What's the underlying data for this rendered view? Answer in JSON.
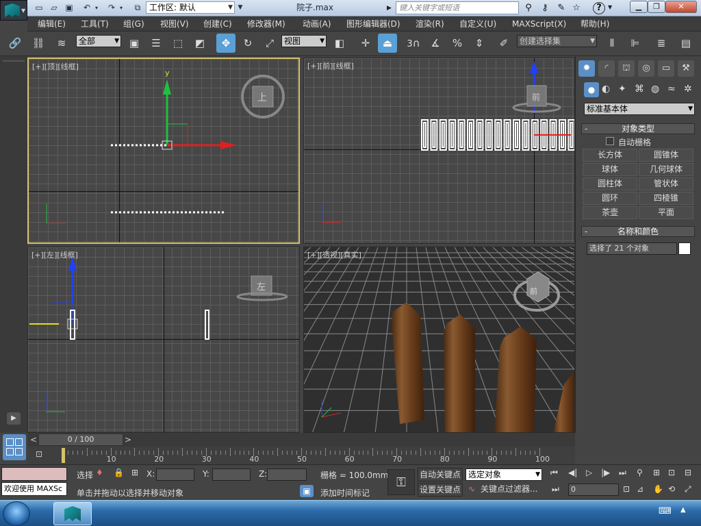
{
  "titlebar": {
    "workspace_label": "工作区: 默认",
    "file_title": "院子.max",
    "search_placeholder": "键入关键字或短语"
  },
  "menubar": {
    "items": [
      "编辑(E)",
      "工具(T)",
      "组(G)",
      "视图(V)",
      "创建(C)",
      "修改器(M)",
      "动画(A)",
      "图形编辑器(D)",
      "渲染(R)",
      "自定义(U)",
      "MAXScript(X)",
      "帮助(H)"
    ]
  },
  "toolbar": {
    "filter_value": "全部",
    "refcoord_value": "视图",
    "snap_number": "3",
    "percent_symbol": "%",
    "selection_set_placeholder": "创建选择集"
  },
  "viewports": {
    "top": {
      "label": "[+][顶][线框]",
      "cube_label": "上"
    },
    "front": {
      "label": "[+][前][线框]",
      "cube_label": "前"
    },
    "left": {
      "label": "[+][左][线框]",
      "cube_label": "左"
    },
    "perspective": {
      "label": "[+][透视][真实]",
      "cube_label": "前"
    }
  },
  "command_panel": {
    "category_value": "标准基本体",
    "object_type_header": "对象类型",
    "autogrid_label": "自动栅格",
    "object_buttons": [
      "长方体",
      "圆锥体",
      "球体",
      "几何球体",
      "圆柱体",
      "管状体",
      "圆环",
      "四棱锥",
      "茶壶",
      "平面"
    ],
    "name_color_header": "名称和颜色",
    "name_field_value": "选择了 21 个对象",
    "object_color": "#ffffff"
  },
  "timeline": {
    "frame_display": "0 / 100",
    "ticks": [
      "0",
      "10",
      "20",
      "30",
      "40",
      "50",
      "60",
      "70",
      "80",
      "90",
      "100"
    ]
  },
  "statusbar": {
    "script_listener_text": "欢迎使用 MAXSc",
    "selection_label": "选择",
    "prompt_text": "单击并拖动以选择并移动对象",
    "x_label": "X:",
    "y_label": "Y:",
    "z_label": "Z:",
    "grid_label": "栅格 = 100.0mm",
    "add_time_tag": "添加时间标记",
    "auto_key": "自动关键点",
    "set_key": "设置关键点",
    "key_mode_value": "选定对象",
    "key_filters": "关键点过滤器...",
    "current_frame": "0"
  },
  "colors": {
    "accent": "#5aa0d6",
    "active_viewport": "#d6c26a",
    "axis_x": "#e02020",
    "axis_y": "#20c040",
    "axis_z": "#2040ff"
  }
}
